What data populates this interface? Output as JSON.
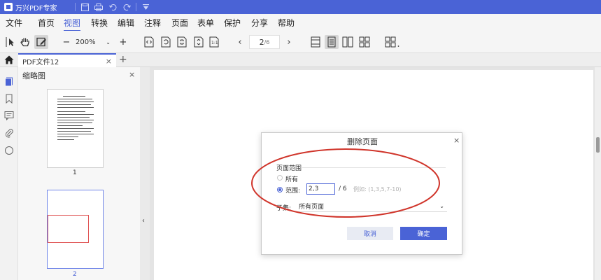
{
  "titlebar": {
    "app_title": "万兴PDF专家"
  },
  "menu": {
    "items": [
      "文件",
      "首页",
      "视图",
      "转换",
      "编辑",
      "注释",
      "页面",
      "表单",
      "保护",
      "分享",
      "帮助"
    ],
    "active": "视图"
  },
  "toolbar": {
    "zoom_value": "200%",
    "current_page": "2",
    "total_pages": "/6"
  },
  "tab": {
    "label": "PDF文件12"
  },
  "thumbnails": {
    "header": "缩略图",
    "pages": [
      {
        "label": "1"
      },
      {
        "label": "2"
      }
    ]
  },
  "dialog": {
    "title": "删除页面",
    "section_label": "页面范围",
    "option_all": "所有",
    "option_range": "范围:",
    "range_value": "2,3",
    "total_label": "/  6",
    "example": "例如:    (1,3,5,7-10)",
    "subset_label": "子集:",
    "subset_value": "所有页面",
    "cancel_label": "取消",
    "ok_label": "确定"
  },
  "colors": {
    "accent": "#4a63d6",
    "annotation": "#d0352b"
  },
  "icons": {
    "qa": [
      "save-icon",
      "print-icon",
      "undo-icon",
      "redo-icon",
      "customize-icon"
    ],
    "tools": [
      "select-icon",
      "hand-icon",
      "edit-icon"
    ],
    "view": [
      "fit-width-icon",
      "rotate-icon",
      "fit-page-icon",
      "fit-height-icon",
      "actual-size-icon"
    ],
    "layout": [
      "single-page-icon",
      "continuous-icon",
      "two-page-icon",
      "two-page-continuous-icon",
      "grid-icon"
    ],
    "sidebar": [
      "thumbnail-icon",
      "bookmark-icon",
      "comment-icon",
      "attachment-icon",
      "search-icon"
    ]
  }
}
